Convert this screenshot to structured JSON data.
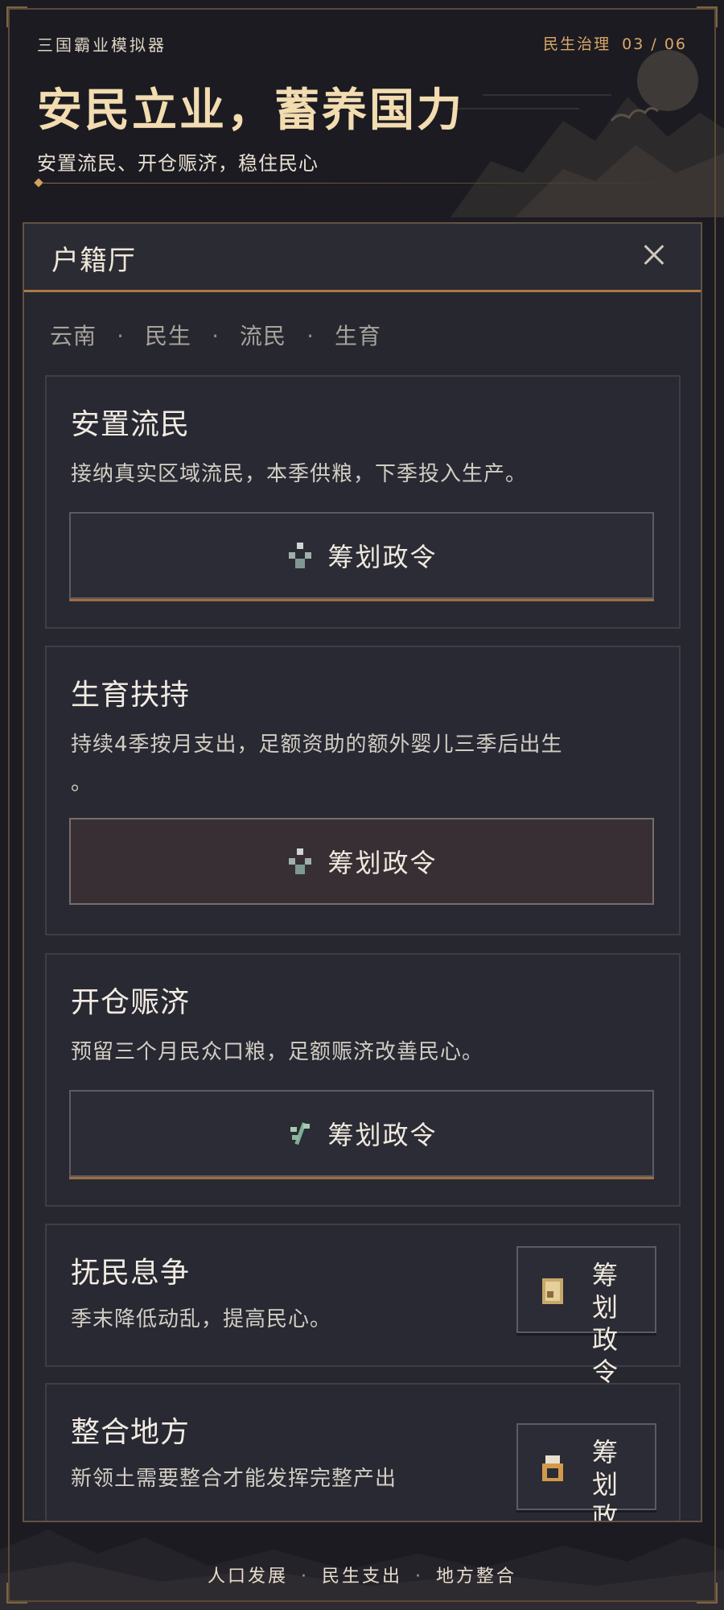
{
  "header": {
    "app_title": "三国霸业模拟器",
    "section_name": "民生治理",
    "page_indicator": "03 / 06",
    "headline": "安民立业，蓄养国力",
    "subhead": "安置流民、开仓赈济，稳住民心"
  },
  "panel": {
    "title": "户籍厅",
    "close_icon": "close-icon",
    "breadcrumb": [
      "云南",
      "民生",
      "流民",
      "生育"
    ]
  },
  "policies": [
    {
      "title": "安置流民",
      "desc": "接纳真实区域流民，本季供粮，下季投入生产。",
      "button_label": "筹划政令",
      "icon": "people-icon"
    },
    {
      "title": "生育扶持",
      "desc_line1": "持续4季按月支出，足额资助的额外婴儿三季后出生",
      "desc_line2": "。",
      "button_label": "筹划政令",
      "icon": "people-icon"
    },
    {
      "title": "开仓赈济",
      "desc": "预留三个月民众口粮，足额赈济改善民心。",
      "button_label": "筹划政令",
      "icon": "grain-icon"
    },
    {
      "title": "抚民息争",
      "desc": "季末降低动乱，提高民心。",
      "button_label_line1": "筹划",
      "button_label_line2": "政令",
      "icon": "scroll-icon"
    },
    {
      "title": "整合地方",
      "desc": "新领土需要整合才能发挥完整产出",
      "button_label_line1": "筹划",
      "button_label_line2": "政令",
      "icon": "seal-icon"
    }
  ],
  "footer": {
    "items": [
      "人口发展",
      "民生支出",
      "地方整合"
    ]
  },
  "colors": {
    "accent": "#d9a867",
    "headline": "#f2dcb0",
    "panel_bg": "#26272f",
    "border": "#615344"
  }
}
